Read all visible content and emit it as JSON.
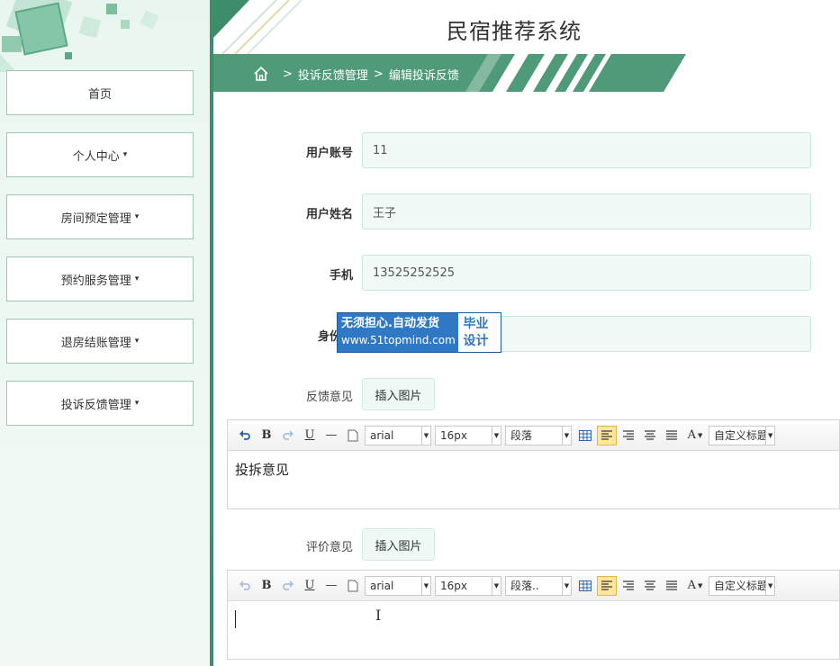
{
  "header": {
    "system_title": "民宿推荐系统"
  },
  "breadcrumb": {
    "sep1": ">",
    "section": "投诉反馈管理",
    "sep2": ">",
    "page": "编辑投诉反馈"
  },
  "sidebar": {
    "items": [
      {
        "label": "首页"
      },
      {
        "label": "个人中心"
      },
      {
        "label": "房间预定管理"
      },
      {
        "label": "预约服务管理"
      },
      {
        "label": "退房结账管理"
      },
      {
        "label": "投诉反馈管理"
      }
    ],
    "caret": "▾"
  },
  "form": {
    "user_account": {
      "label": "用户账号",
      "value": "11"
    },
    "user_name": {
      "label": "用户姓名",
      "value": "王子"
    },
    "phone": {
      "label": "手机",
      "value": "13525252525"
    },
    "id_card": {
      "label": "身份证",
      "value": ""
    },
    "feedback": {
      "label": "反馈意见",
      "insert_image": "插入图片",
      "content": "投拆意见"
    },
    "evaluation": {
      "label": "评价意见",
      "insert_image": "插入图片",
      "content": ""
    }
  },
  "watermark": {
    "line1": "无须担心.自动发货",
    "line2": "www.51topmind.com",
    "right1": "毕业",
    "right2": "设计"
  },
  "toolbar1": {
    "font": "arial",
    "size": "16px",
    "paragraph": "段落",
    "custom_title": "自定义标题"
  },
  "toolbar2": {
    "font": "arial",
    "size": "16px",
    "paragraph": "段落..",
    "custom_title": "自定义标题"
  },
  "icons": {
    "undo": "undo-icon",
    "bold": "B",
    "redo": "redo-icon",
    "underline": "U",
    "hr": "—",
    "font_color": "A"
  },
  "colors": {
    "primary_green": "#3d8c6a",
    "input_bg": "#f1faf7",
    "watermark_blue": "#2f78c4"
  }
}
